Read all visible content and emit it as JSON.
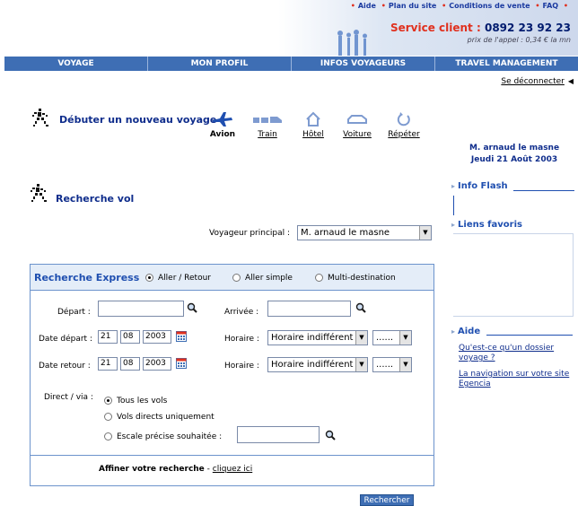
{
  "header": {
    "top_links": [
      "Aide",
      "Plan du site",
      "Conditions de vente",
      "FAQ"
    ],
    "service_label": "Service client :",
    "service_number": "0892 23 92 23",
    "service_sub": "prix de l'appel : 0,34 € la mn"
  },
  "nav": {
    "items": [
      "VOYAGE",
      "MON PROFIL",
      "INFOS VOYAGEURS",
      "TRAVEL MANAGEMENT"
    ]
  },
  "logout": "Se déconnecter",
  "new_trip": {
    "title": "Débuter un nouveau voyage",
    "modes": [
      "Avion",
      "Train",
      "Hôtel",
      "Voiture",
      "Répéter"
    ]
  },
  "user": {
    "name": "M. arnaud le masne",
    "date": "Jeudi 21 Août 2003"
  },
  "sidebar": {
    "info_flash": "Info Flash",
    "liens_favoris": "Liens favoris",
    "aide": "Aide",
    "aide_links": [
      "Qu'est-ce qu'un dossier voyage ?",
      "La navigation sur votre site Egencia"
    ]
  },
  "search": {
    "title": "Recherche vol",
    "voyageur_label": "Voyageur principal :",
    "voyageur_value": "M. arnaud le masne",
    "express": {
      "title": "Recherche Express",
      "trip_types": [
        "Aller / Retour",
        "Aller simple",
        "Multi-destination"
      ],
      "selected_trip_type": "Aller / Retour",
      "depart_label": "Départ :",
      "depart_value": "",
      "arrivee_label": "Arrivée :",
      "arrivee_value": "",
      "date_depart_label": "Date départ :",
      "date_depart": {
        "day": "21",
        "month": "08",
        "year": "2003"
      },
      "date_retour_label": "Date retour :",
      "date_retour": {
        "day": "21",
        "month": "08",
        "year": "2003"
      },
      "horaire_label": "Horaire :",
      "horaire_value": "Horaire indifférent",
      "time_value": "......",
      "direct_label": "Direct / via :",
      "direct_options": [
        "Tous les vols",
        "Vols directs uniquement",
        "Escale précise souhaitée :"
      ],
      "selected_direct": "Tous les vols",
      "escale_value": "",
      "affiner_label": "Affiner votre recherche",
      "affiner_sep": "-",
      "affiner_link": "cliquez ici"
    },
    "submit": "Rechercher"
  },
  "colors": {
    "nav_bg": "#3e6eb4",
    "title_blue": "#0f2d8c",
    "link_red": "#e0301e",
    "box_border": "#6c93cc",
    "box_header_bg": "#e4edf8"
  }
}
